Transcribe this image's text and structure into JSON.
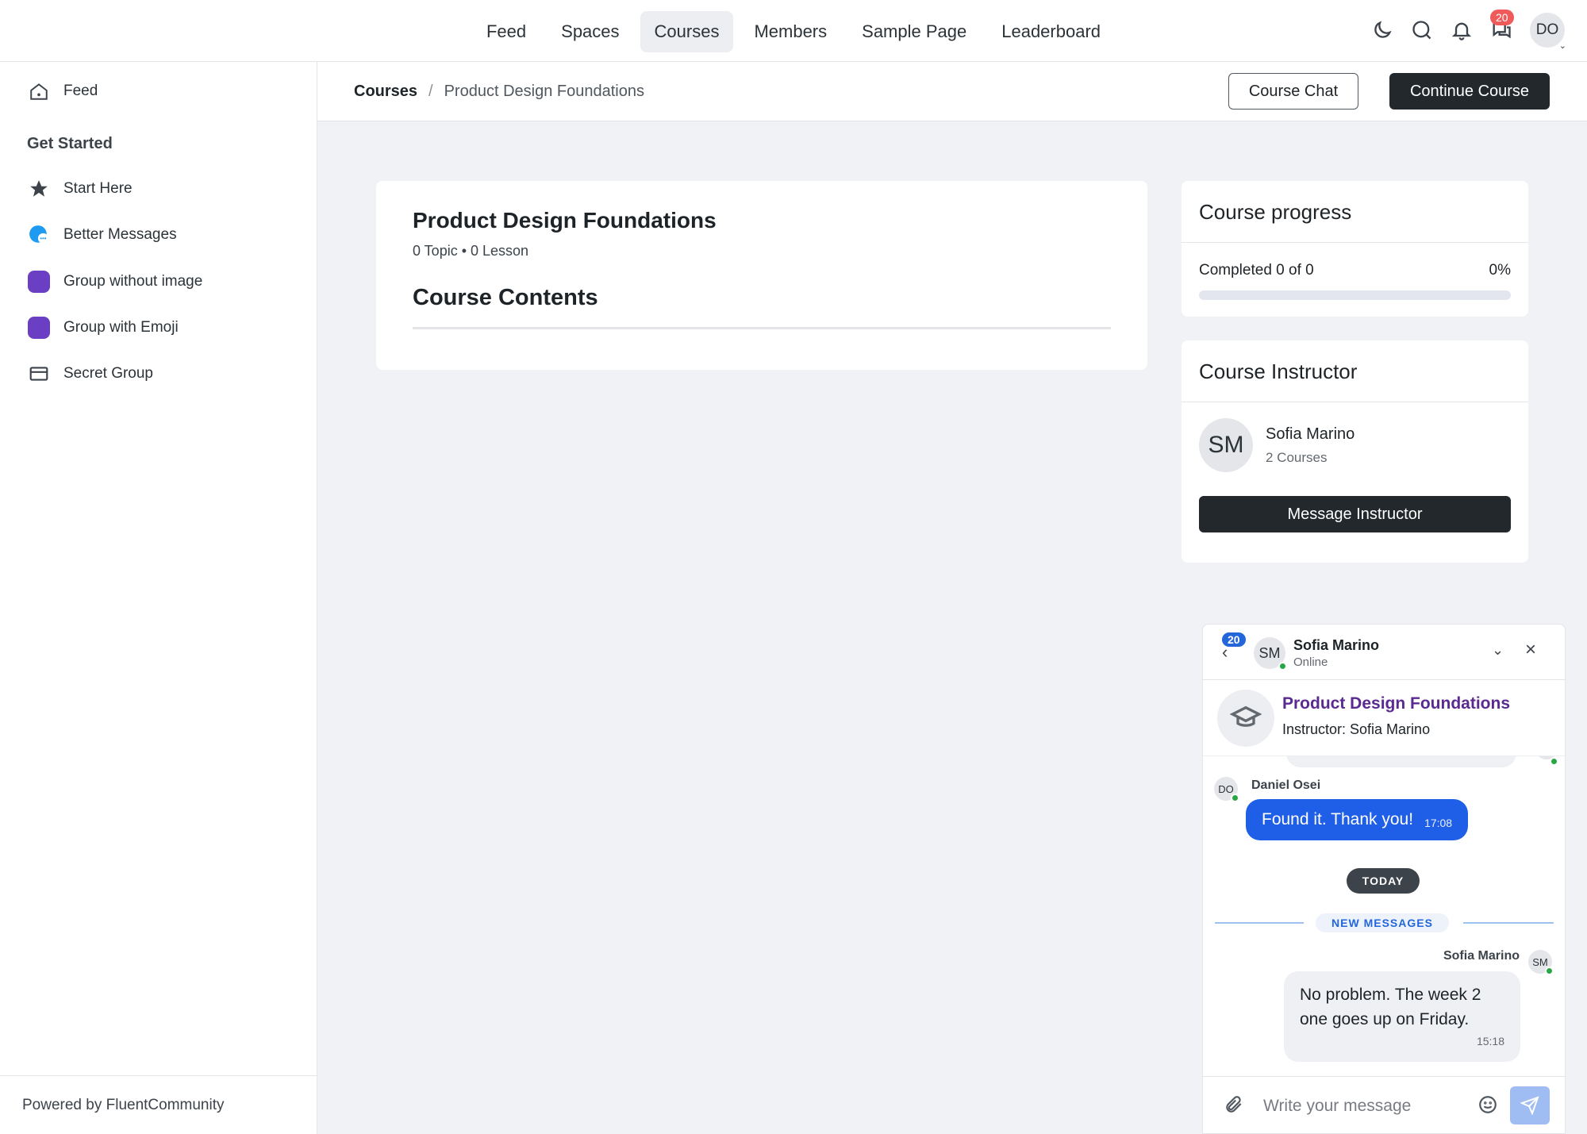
{
  "topnav": {
    "items": [
      {
        "label": "Feed"
      },
      {
        "label": "Spaces"
      },
      {
        "label": "Courses",
        "active": true
      },
      {
        "label": "Members"
      },
      {
        "label": "Sample Page"
      },
      {
        "label": "Leaderboard"
      }
    ],
    "messages_badge": "20",
    "avatar_initials": "DO"
  },
  "sidebar": {
    "feed_label": "Feed",
    "heading": "Get Started",
    "items": [
      {
        "label": "Start Here",
        "icon": "star-icon"
      },
      {
        "label": "Better Messages",
        "icon": "chat-bubble-icon"
      },
      {
        "label": "Group without image",
        "icon": "purple-square-icon"
      },
      {
        "label": "Group with Emoji",
        "icon": "purple-square-icon"
      },
      {
        "label": "Secret Group",
        "icon": "card-icon"
      }
    ],
    "footer": "Powered by FluentCommunity"
  },
  "header": {
    "breadcrumb_root": "Courses",
    "breadcrumb_sep": "/",
    "breadcrumb_current": "Product Design Foundations",
    "course_chat_label": "Course Chat",
    "continue_label": "Continue Course"
  },
  "course": {
    "title": "Product Design Foundations",
    "meta": "0 Topic • 0 Lesson",
    "contents_heading": "Course Contents"
  },
  "progress": {
    "title": "Course progress",
    "completed_text": "Completed 0 of 0",
    "percent_text": "0%",
    "percent": 0
  },
  "instructor": {
    "title": "Course Instructor",
    "initials": "SM",
    "name": "Sofia Marino",
    "courses": "2 Courses",
    "message_label": "Message Instructor"
  },
  "chat": {
    "badge": "20",
    "avatar_initials": "SM",
    "name": "Sofia Marino",
    "status": "Online",
    "course_title": "Product Design Foundations",
    "course_instructor": "Instructor: Sofia Marino",
    "msg1_sender": "Daniel Osei",
    "msg1_initials": "DO",
    "msg1_text": "Found it. Thank you!",
    "msg1_time": "17:08",
    "today_label": "TODAY",
    "new_messages_label": "NEW MESSAGES",
    "msg2_sender": "Sofia Marino",
    "msg2_initials": "SM",
    "msg2_text": "No problem. The week 2 one goes up on Friday.",
    "msg2_time": "15:18",
    "input_placeholder": "Write your message"
  },
  "colors": {
    "accent_dark": "#23282d",
    "chat_blue": "#1f5ee6",
    "course_link": "#5b2a91",
    "group_purple": "#6a3fc4",
    "badge_red": "#ef5a5a"
  }
}
